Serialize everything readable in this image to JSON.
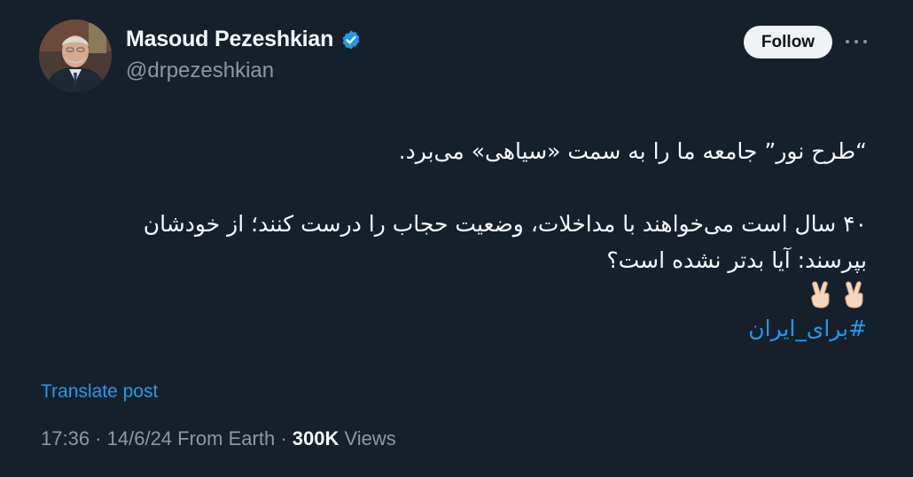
{
  "author": {
    "display_name": "Masoud Pezeshkian",
    "handle": "@drpezeshkian",
    "verified": true
  },
  "actions": {
    "follow_label": "Follow",
    "more_icon": "more-horizontal-icon",
    "translate_label": "Translate post"
  },
  "tweet": {
    "line1": "“طرح نور” جامعه ما را به سمت «سیاهی» می‌برد.",
    "line2": "۴۰ سال است می‌خواهند با مداخلات، وضعیت حجاب را درست کنند؛ از خودشان بپرسند: آیا بدتر نشده است؟",
    "emoji_line": "✌🏻✌🏻",
    "hashtag": "#برای_ایران"
  },
  "meta": {
    "time": "17:36",
    "date": "14/6/24",
    "source": "From Earth",
    "views_count": "300K",
    "views_label": "Views",
    "separator": "·"
  },
  "colors": {
    "background": "#15202b",
    "accent": "#1d9bf0",
    "secondary_text": "#8b98a5"
  }
}
